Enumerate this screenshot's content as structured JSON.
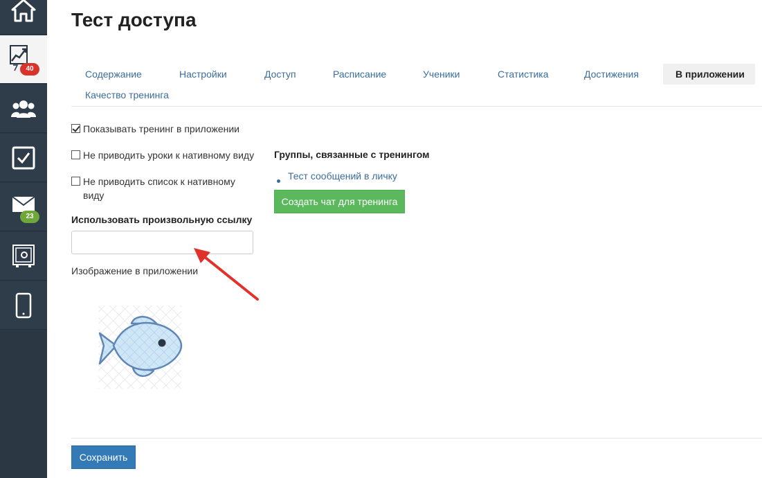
{
  "sidebar": {
    "items": [
      {
        "icon": "home-icon"
      },
      {
        "icon": "trainings-chart-icon",
        "badge": "40",
        "badge_color": "#d9342b"
      },
      {
        "icon": "users-group-icon"
      },
      {
        "icon": "tasks-checkbox-icon"
      },
      {
        "icon": "mail-icon",
        "badge": "23",
        "badge_color": "#6ea83a"
      },
      {
        "icon": "safe-icon"
      },
      {
        "icon": "mobile-phone-icon"
      }
    ]
  },
  "page": {
    "title": "Тест доступа"
  },
  "tabs": [
    {
      "label": "Содержание"
    },
    {
      "label": "Настройки"
    },
    {
      "label": "Доступ"
    },
    {
      "label": "Расписание"
    },
    {
      "label": "Ученики"
    },
    {
      "label": "Статистика"
    },
    {
      "label": "Достижения"
    },
    {
      "label": "В приложении",
      "active": true
    },
    {
      "label": "Качество тренинга"
    }
  ],
  "settings": {
    "show_in_app": {
      "label": "Показывать тренинг в приложении",
      "checked": true
    },
    "no_native_lessons": {
      "label": "Не приводить уроки к нативному виду",
      "checked": false
    },
    "no_native_list": {
      "label_line1": "Не приводить список к нативному",
      "label_line2": "виду",
      "checked": false
    },
    "custom_link": {
      "label": "Использовать произвольную ссылку",
      "value": "",
      "placeholder": ""
    },
    "app_image": {
      "label": "Изображение в приложении",
      "icon": "fish-icon"
    }
  },
  "groups": {
    "heading": "Группы, связанные с тренингом",
    "items": [
      "Тест сообщений в личку"
    ],
    "create_button": "Создать чат для тренинга"
  },
  "footer": {
    "save_button": "Сохранить"
  },
  "colors": {
    "sidebar_bg": "#2f3d4b",
    "link": "#3b6d9c",
    "success": "#5cb85c",
    "primary": "#337ab7",
    "annotation_arrow": "#e0322b"
  }
}
